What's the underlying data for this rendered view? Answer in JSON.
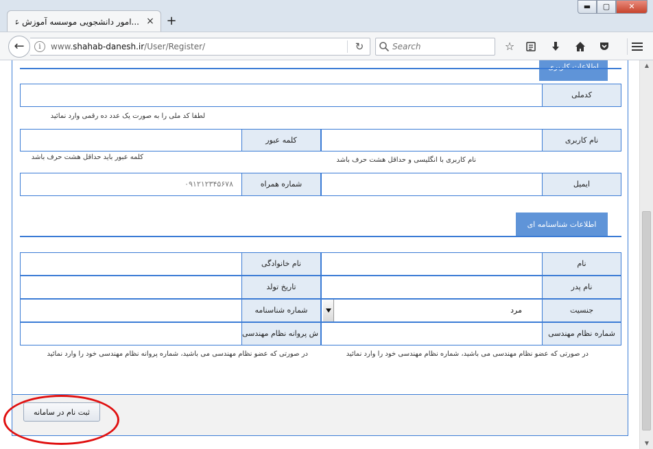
{
  "browser": {
    "tab_title": "...امور دانشجویی موسسه آموزش عال",
    "tab_close": "×",
    "new_tab": "+",
    "url_prefix": "www.",
    "url_domain": "shahab-danesh.ir",
    "url_path": "/User/Register/",
    "search_placeholder": "Search",
    "window_min": "▬",
    "window_max": "▢",
    "window_close": "✕",
    "icons": [
      "back-arrow-icon",
      "info-icon",
      "reload-icon",
      "search-icon",
      "bookmark-star-icon",
      "reading-list-icon",
      "download-icon",
      "home-icon",
      "pocket-icon",
      "hamburger-menu-icon"
    ]
  },
  "section1": {
    "title": "اطلاعات کاربری",
    "national_code_label": "کدملی",
    "national_code_hint": "لطفا کد ملی را به صورت یک عدد ده رقمی وارد نمائید",
    "username_label": "نام کاربری",
    "username_hint": "نام کاربری با انگلیسی و حداقل هشت حرف باشد",
    "password_label": "کلمه عبور",
    "password_hint": "کلمه عبور باید حداقل هشت حرف باشد",
    "email_label": "ایمیل",
    "mobile_label": "شماره همراه",
    "mobile_placeholder": "۰۹۱۲۱۲۳۴۵۶۷۸"
  },
  "section2": {
    "title": "اطلاعات شناسنامه ای",
    "first_name_label": "نام",
    "last_name_label": "نام خانوادگی",
    "father_name_label": "نام پدر",
    "birth_date_label": "تاریخ تولد",
    "gender_label": "جنسیت",
    "gender_value": "مرد",
    "id_number_label": "شماره شناسنامه",
    "engineering_number_label": "شماره نظام مهندسی",
    "engineering_license_label": "ش پروانه نظام مهندسی",
    "engineering_number_hint": "در صورتی که عضو نظام مهندسی می باشید، شماره نظام مهندسی خود را وارد نمائید",
    "engineering_license_hint": "در صورتی که عضو نظام مهندسی می باشید، شماره پروانه نظام مهندسی خود را وارد نمائید"
  },
  "footer": {
    "submit_label": "ثبت نام در سامانه"
  },
  "colors": {
    "accent": "#3a7bd5",
    "section_header": "#5f94d8",
    "label_bg": "#e2ebf5",
    "highlight": "#e01010"
  }
}
